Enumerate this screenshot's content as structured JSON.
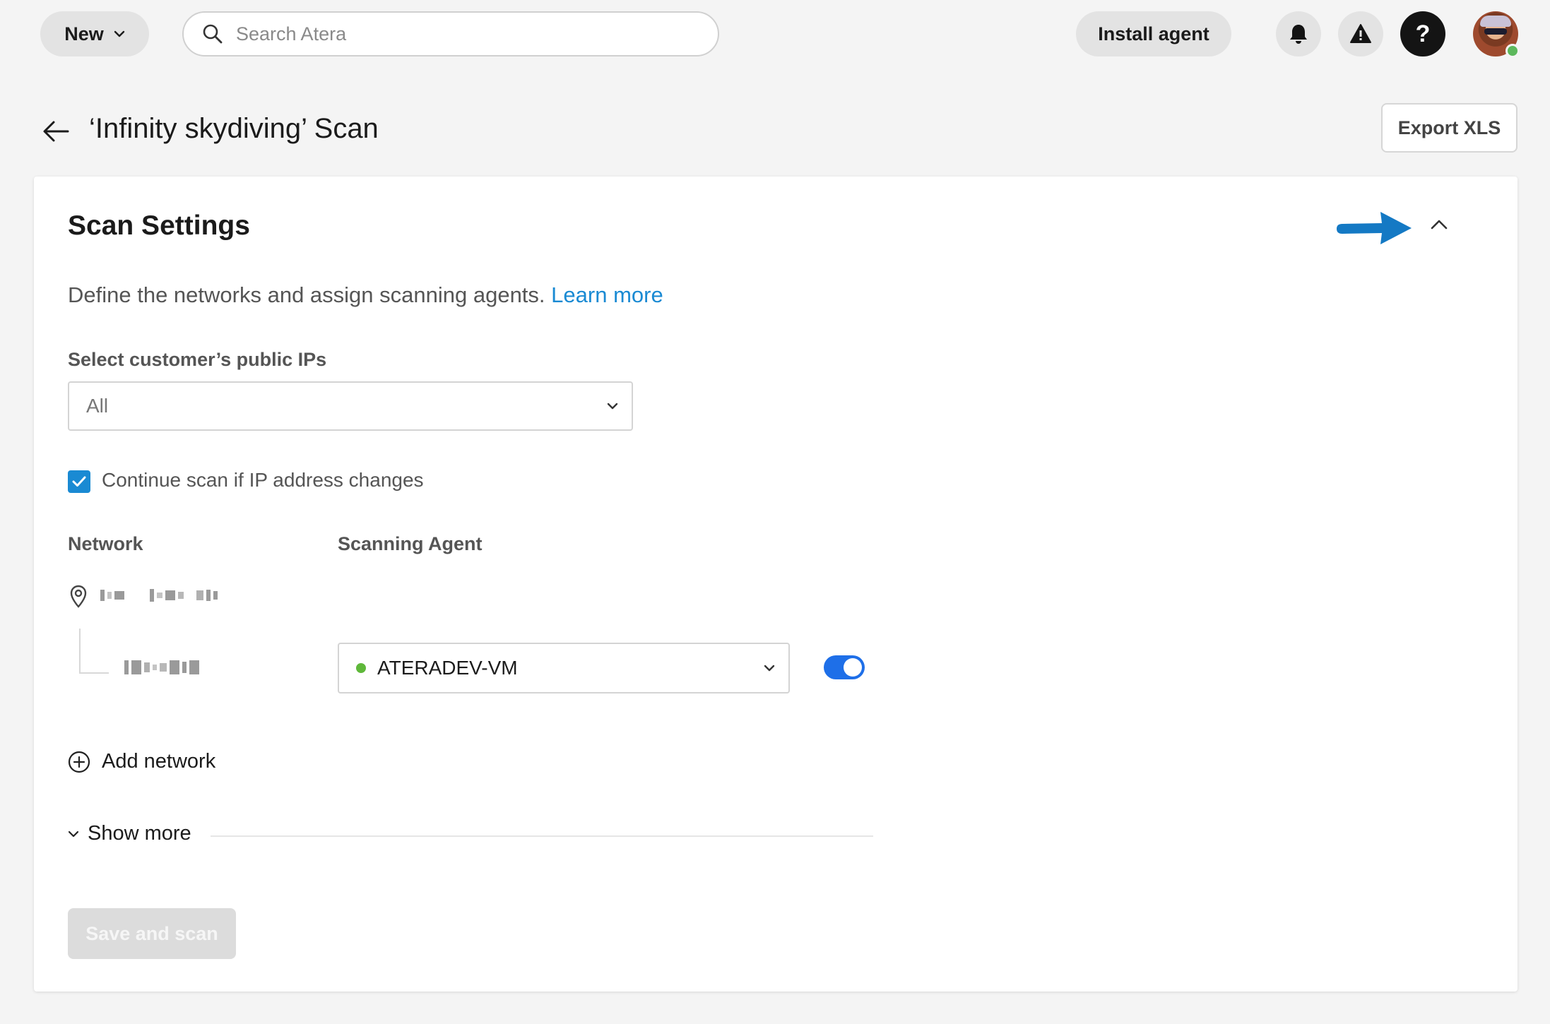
{
  "topbar": {
    "new_label": "New",
    "search_placeholder": "Search Atera",
    "install_label": "Install agent",
    "help_label": "?"
  },
  "page": {
    "title": "‘Infinity skydiving’ Scan",
    "export_label": "Export XLS"
  },
  "scan_settings": {
    "title": "Scan Settings",
    "description": "Define the networks and assign scanning agents.",
    "learn_more": "Learn more",
    "public_ip_label": "Select customer’s public IPs",
    "public_ip_value": "All",
    "continue_scan_label": "Continue scan if IP address changes",
    "continue_scan_checked": true,
    "columns": {
      "network": "Network",
      "agent": "Scanning Agent"
    },
    "network_row": {
      "agent_name": "ATERADEV-VM",
      "agent_status_color": "#5fb83a",
      "enabled": true
    },
    "add_network_label": "Add network",
    "show_more_label": "Show more",
    "save_label": "Save and scan"
  },
  "colors": {
    "accent": "#1a8ad3",
    "toggle": "#1e6fe8",
    "annotation_arrow": "#1479c4"
  }
}
